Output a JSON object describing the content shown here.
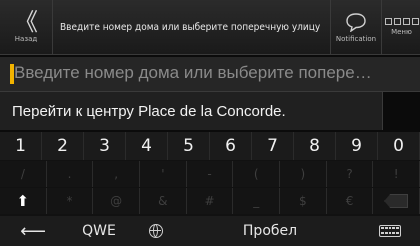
{
  "header": {
    "back_glyph": "《",
    "back_label": "Назад",
    "title": "Введите номер дома или выберите поперечную улицу",
    "notification_label": "Notification",
    "menu_label": "Меню"
  },
  "input": {
    "placeholder": "Введите номер дома или выберите попере…"
  },
  "suggestion": {
    "text": "Перейти к центру Place de la Concorde."
  },
  "keyboard": {
    "digits": [
      "1",
      "2",
      "3",
      "4",
      "5",
      "6",
      "7",
      "8",
      "9",
      "0"
    ],
    "symbols_row": [
      "/",
      ".",
      ",",
      "'",
      "-",
      "(",
      ")",
      "?",
      "!"
    ],
    "symbols_row2": [
      "*",
      "@",
      "&",
      "#",
      "_",
      "$",
      "€"
    ],
    "shift_glyph": "⬆",
    "left_arrow_glyph": "⟵",
    "qwe_label": "QWE",
    "space_label": "Пробел"
  }
}
